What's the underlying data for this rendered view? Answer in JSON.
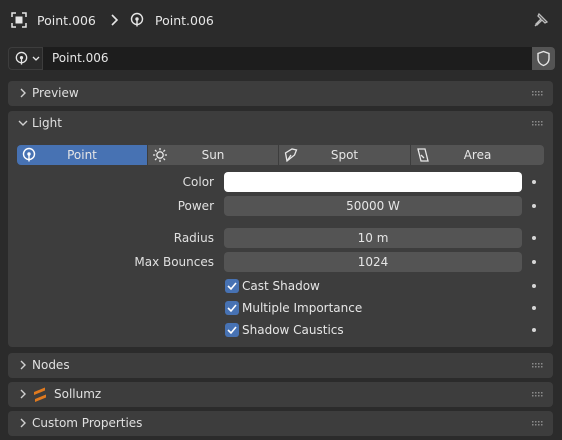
{
  "breadcrumb": {
    "object_name": "Point.006",
    "data_name": "Point.006"
  },
  "name_row": {
    "datablock_name": "Point.006"
  },
  "panels": {
    "preview": "Preview",
    "light": "Light",
    "nodes": "Nodes",
    "sollumz": "Sollumz",
    "custom_properties": "Custom Properties"
  },
  "light_types": [
    {
      "label": "Point",
      "icon": "point-light-icon",
      "active": true
    },
    {
      "label": "Sun",
      "icon": "sun-icon",
      "active": false
    },
    {
      "label": "Spot",
      "icon": "spot-light-icon",
      "active": false
    },
    {
      "label": "Area",
      "icon": "area-light-icon",
      "active": false
    }
  ],
  "properties": {
    "color_label": "Color",
    "color_value": "#ffffff",
    "power_label": "Power",
    "power_value": "50000 W",
    "radius_label": "Radius",
    "radius_value": "10 m",
    "max_bounces_label": "Max Bounces",
    "max_bounces_value": "1024"
  },
  "checkboxes": [
    {
      "label": "Cast Shadow",
      "checked": true
    },
    {
      "label": "Multiple Importance",
      "checked": true
    },
    {
      "label": "Shadow Caustics",
      "checked": true
    }
  ],
  "colors": {
    "accent": "#4772b3",
    "panel": "#3d3d3d",
    "background": "#2b2b2b",
    "field": "#545454",
    "sollumz_icon": "#e07a1f"
  }
}
